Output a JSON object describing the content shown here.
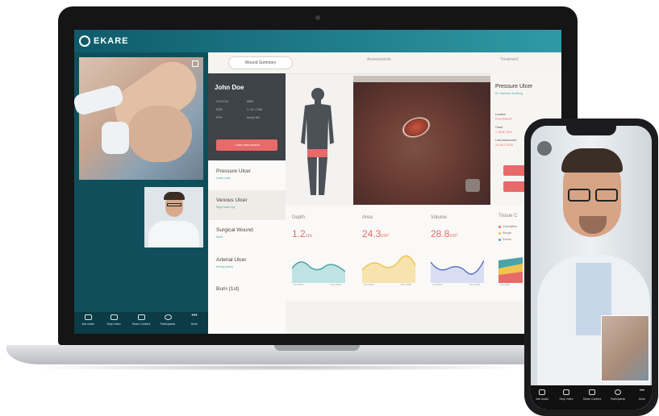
{
  "app": {
    "logo_text": "EKARE",
    "brand_color": "#1f7f8c",
    "accent_color": "#e86a6a"
  },
  "tabs": [
    {
      "label": "Wound Summary"
    },
    {
      "label": "Assessments"
    },
    {
      "label": "Treatment"
    }
  ],
  "patient": {
    "name": "John Doe",
    "lines": [
      "XXX-XXX",
      "DOB",
      "PPH",
      "MRN",
      "1 / 01 / 1962",
      "Mount Hill"
    ],
    "add_button": "+ Add new wound"
  },
  "wounds": [
    {
      "label": "Pressure Ulcer",
      "sub": "Lower back"
    },
    {
      "label": "Venous Ulcer",
      "sub": "Right lower leg"
    },
    {
      "label": "Surgical Wound",
      "sub": "Neck"
    },
    {
      "label": "Arterial Ulcer",
      "sub": "left leg (back)"
    },
    {
      "label": "Burn (1st)",
      "sub": ""
    }
  ],
  "details": {
    "title": "Pressure Ulcer",
    "doctor": "Dr. Solomon Zoolberg",
    "location_label": "Location",
    "location_value": "POSTERIOR",
    "onset_label": "Onset",
    "onset_value": "1 JUNE 2019",
    "last_label": "Last Assessment",
    "last_value": "15 JULY 2019"
  },
  "metrics": [
    {
      "label": "Depth",
      "value": "1.2",
      "unit": "cm",
      "tick_start": "Oct 2019",
      "tick_end": "Dec 2019"
    },
    {
      "label": "Area",
      "value": "24.3",
      "unit": "cm²",
      "tick_start": "Oct 2019",
      "tick_end": "Dec 2019"
    },
    {
      "label": "Volume",
      "value": "28.8",
      "unit": "cm³",
      "tick_start": "Oct 2019",
      "tick_end": "Dec 2019"
    }
  ],
  "tissue": {
    "title": "Tissue C",
    "legend": [
      {
        "label": "Granulation",
        "color": "#e86a6a"
      },
      {
        "label": "Slough",
        "color": "#f0c54e"
      },
      {
        "label": "Eschar",
        "color": "#4aa3a8"
      }
    ],
    "tick": "Oct 2019"
  },
  "meeting_bar": {
    "items": [
      {
        "label": "Join Audio",
        "icon": "headphones-icon"
      },
      {
        "label": "Stop Video",
        "icon": "video-icon"
      },
      {
        "label": "Share Content",
        "icon": "share-icon"
      },
      {
        "label": "Participants",
        "icon": "chat-icon"
      },
      {
        "label": "More",
        "icon": "more-icon"
      }
    ]
  },
  "phone_bar": {
    "items": [
      {
        "label": "Join Audio",
        "icon": "headphones-icon"
      },
      {
        "label": "Stop Video",
        "icon": "video-icon"
      },
      {
        "label": "Share Content",
        "icon": "share-icon"
      },
      {
        "label": "Participants",
        "icon": "chat-icon"
      },
      {
        "label": "More",
        "icon": "more-icon"
      }
    ]
  }
}
